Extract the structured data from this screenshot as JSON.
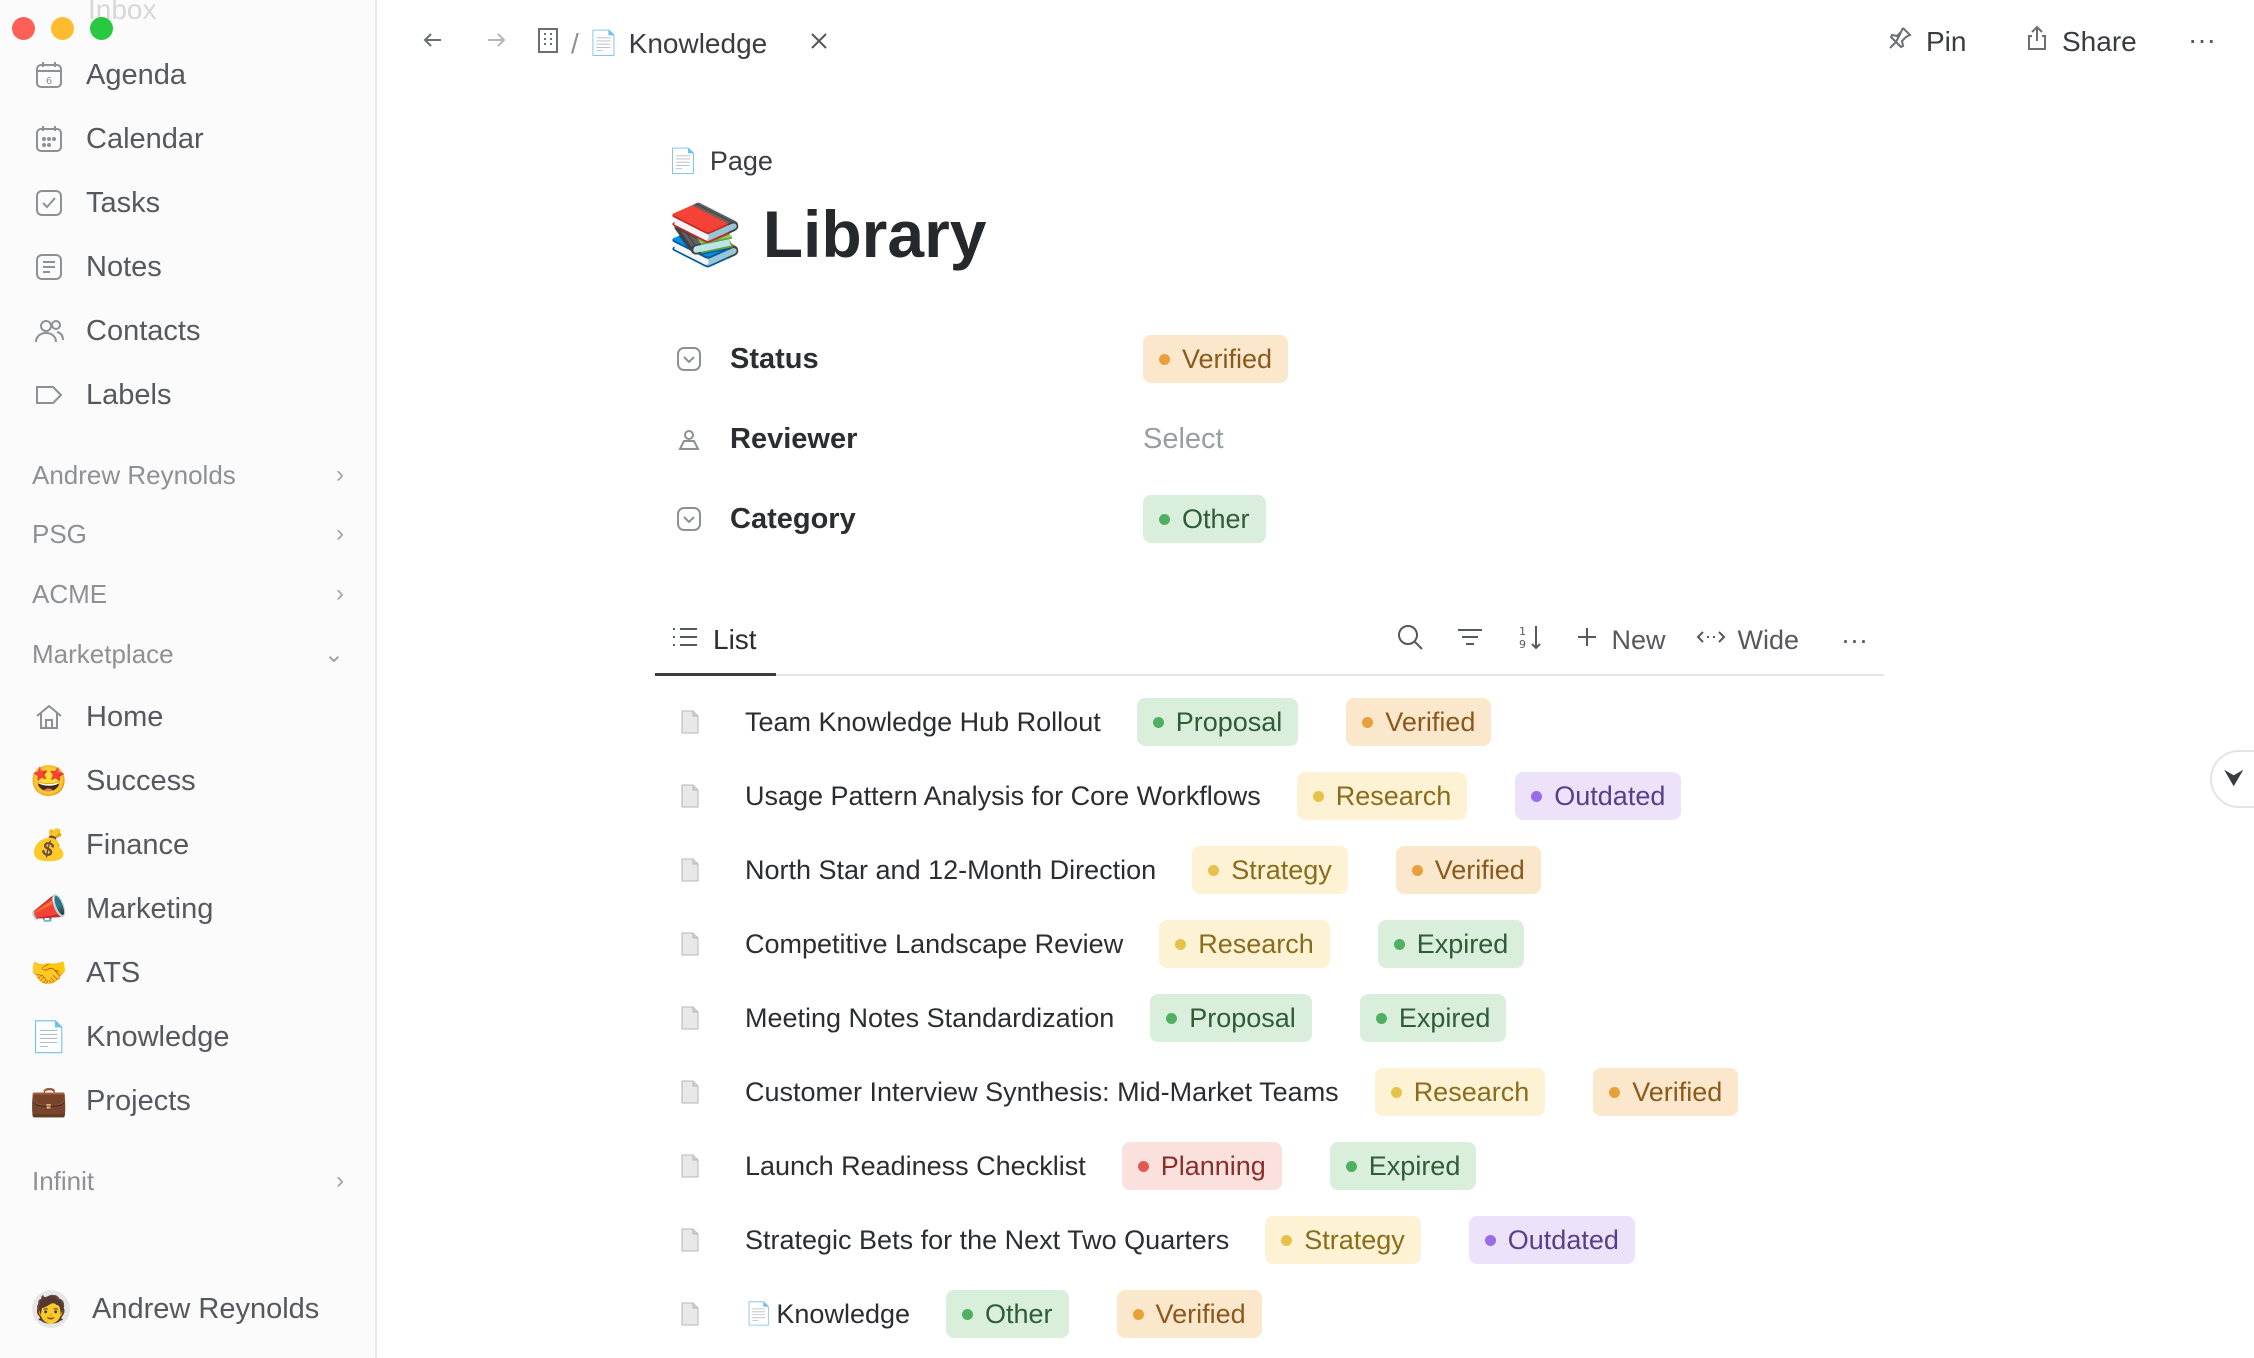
{
  "sidebar": {
    "inbox_label": "Inbox",
    "nav": [
      {
        "label": "Agenda",
        "icon": "agenda-calendar-icon"
      },
      {
        "label": "Calendar",
        "icon": "calendar-icon"
      },
      {
        "label": "Tasks",
        "icon": "checkbox-icon"
      },
      {
        "label": "Notes",
        "icon": "notes-icon"
      },
      {
        "label": "Contacts",
        "icon": "contacts-icon"
      },
      {
        "label": "Labels",
        "icon": "label-tag-icon"
      }
    ],
    "groups": [
      {
        "label": "Andrew Reynolds",
        "state": "collapsed"
      },
      {
        "label": "PSG",
        "state": "collapsed"
      },
      {
        "label": "ACME",
        "state": "collapsed"
      },
      {
        "label": "Marketplace",
        "state": "expanded"
      }
    ],
    "marketplace_items": [
      {
        "label": "Home",
        "icon": "home-icon",
        "glyph": "⌂"
      },
      {
        "label": "Success",
        "icon": "star-struck-emoji-icon",
        "glyph": "🤩"
      },
      {
        "label": "Finance",
        "icon": "money-bag-emoji-icon",
        "glyph": "💰"
      },
      {
        "label": "Marketing",
        "icon": "megaphone-emoji-icon",
        "glyph": "📣"
      },
      {
        "label": "ATS",
        "icon": "handshake-emoji-icon",
        "glyph": "🤝"
      },
      {
        "label": "Knowledge",
        "icon": "document-emoji-icon",
        "glyph": "📄"
      },
      {
        "label": "Projects",
        "icon": "briefcase-emoji-icon",
        "glyph": "💼"
      }
    ],
    "infinit_label": "Infinit",
    "user_name": "Andrew Reynolds"
  },
  "topbar": {
    "breadcrumb_sep": "/",
    "breadcrumb_current": "Knowledge",
    "pin_label": "Pin",
    "share_label": "Share",
    "more_label": "···"
  },
  "page": {
    "type_label": "Page",
    "title": "Library",
    "title_emoji": "📚",
    "properties": {
      "status": {
        "name": "Status",
        "value": "Verified"
      },
      "reviewer": {
        "name": "Reviewer",
        "placeholder": "Select"
      },
      "category": {
        "name": "Category",
        "value": "Other"
      }
    }
  },
  "list": {
    "tab_label": "List",
    "new_label": "New",
    "wide_label": "Wide",
    "more_label": "···",
    "rows": [
      {
        "title": "Team Knowledge Hub Rollout",
        "category": "Proposal",
        "status": "Verified"
      },
      {
        "title": "Usage Pattern Analysis for Core Workflows",
        "category": "Research",
        "status": "Outdated"
      },
      {
        "title": "North Star and 12-Month Direction",
        "category": "Strategy",
        "status": "Verified"
      },
      {
        "title": "Competitive Landscape Review",
        "category": "Research",
        "status": "Expired"
      },
      {
        "title": "Meeting Notes Standardization",
        "category": "Proposal",
        "status": "Expired"
      },
      {
        "title": "Customer Interview Synthesis: Mid-Market Teams",
        "category": "Research",
        "status": "Verified"
      },
      {
        "title": "Launch Readiness Checklist",
        "category": "Planning",
        "status": "Expired"
      },
      {
        "title": "Strategic Bets for the Next Two Quarters",
        "category": "Strategy",
        "status": "Outdated"
      },
      {
        "title": "Knowledge",
        "category": "Other",
        "status": "Verified",
        "has_doc_emoji": true
      }
    ]
  },
  "tag_colors": {
    "Verified": {
      "bg": "#fbe7cc",
      "fg": "#8a5a1c",
      "dot": "#e8a13a"
    },
    "Proposal": {
      "bg": "#d9efdc",
      "fg": "#2f5b36",
      "dot": "#4fb061"
    },
    "Other": {
      "bg": "#d9efdc",
      "fg": "#2f5b36",
      "dot": "#4fb061"
    },
    "Expired": {
      "bg": "#d9efdc",
      "fg": "#2f5b36",
      "dot": "#4fb061"
    },
    "Research": {
      "bg": "#fdf3d4",
      "fg": "#8a6c1c",
      "dot": "#e6c14b"
    },
    "Strategy": {
      "bg": "#fdf3d4",
      "fg": "#8a6c1c",
      "dot": "#e6c14b"
    },
    "Outdated": {
      "bg": "#ece3fb",
      "fg": "#57408a",
      "dot": "#9b6be8"
    },
    "Planning": {
      "bg": "#fbe1de",
      "fg": "#8a2f28",
      "dot": "#e35a4f"
    }
  }
}
